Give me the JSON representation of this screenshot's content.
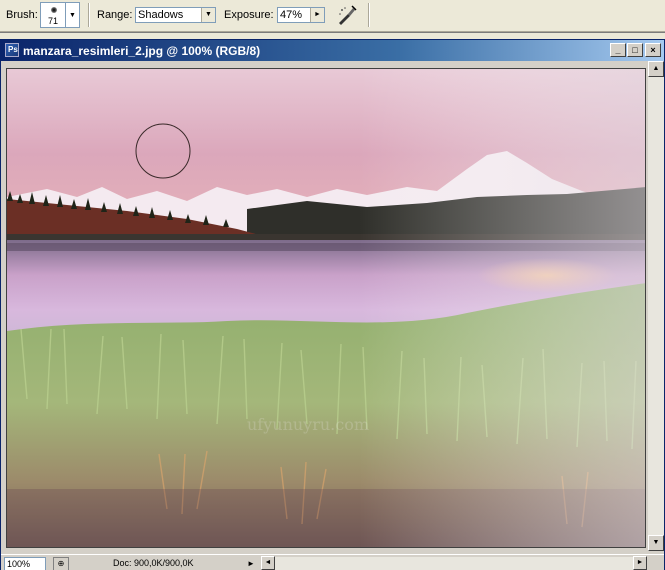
{
  "options": {
    "brush_label": "Brush:",
    "brush_size": "71",
    "range_label": "Range:",
    "range_value": "Shadows",
    "exposure_label": "Exposure:",
    "exposure_value": "47%",
    "airbrush_icon": "airbrush-icon"
  },
  "window": {
    "title": "manzara_resimleri_2.jpg @ 100% (RGB/8)",
    "buttons": {
      "minimize": "_",
      "maximize": "□",
      "close": "×"
    }
  },
  "canvas": {
    "watermark": "ufyunuyru.com"
  },
  "status": {
    "zoom": "100%",
    "doc": "Doc: 900,0K/900,0K"
  }
}
